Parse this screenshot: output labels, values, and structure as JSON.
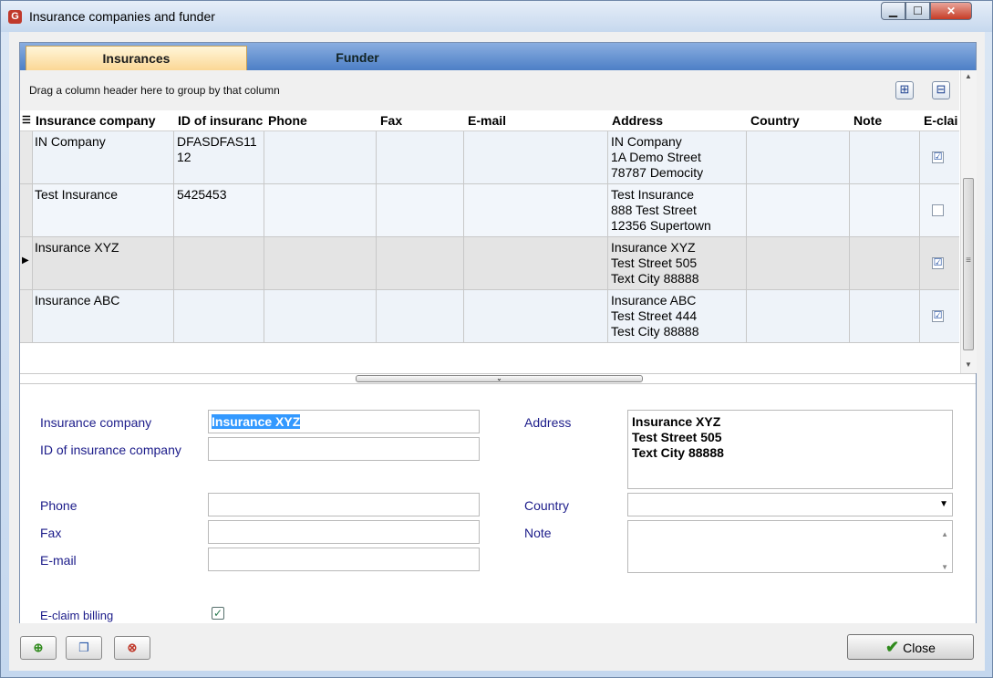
{
  "window": {
    "title": "Insurance companies and funder",
    "app_icon": "G"
  },
  "tabs": [
    {
      "label": "Insurances"
    },
    {
      "label": "Funder"
    }
  ],
  "grid": {
    "group_hint": "Drag a column header here to group by that column",
    "expand_icon": "⊞",
    "collapse_icon": "⊟",
    "headers": [
      "Insurance company",
      "ID of insurance",
      "Phone",
      "Fax",
      "E-mail",
      "Address",
      "Country",
      "Note",
      "E-clai"
    ],
    "rows": [
      {
        "company": "IN Company",
        "id_line1": "DFASDFAS11",
        "id_line2": "12",
        "addr1": "IN Company",
        "addr2": "1A Demo Street",
        "addr3": "78787 Democity",
        "eclaim": "☑"
      },
      {
        "company": "Test Insurance",
        "id_line1": "5425453",
        "id_line2": "",
        "addr1": "Test Insurance",
        "addr2": "888 Test Street",
        "addr3": "12356 Supertown",
        "eclaim": ""
      },
      {
        "company": "Insurance XYZ",
        "id_line1": "",
        "id_line2": "",
        "addr1": "Insurance XYZ",
        "addr2": "Test Street 505",
        "addr3": "Text City 88888",
        "eclaim": "☑"
      },
      {
        "company": "Insurance ABC",
        "id_line1": "",
        "id_line2": "",
        "addr1": "Insurance ABC",
        "addr2": "Test Street 444",
        "addr3": "Test City 88888",
        "eclaim": "☑"
      }
    ]
  },
  "form": {
    "company_label": "Insurance company",
    "company_value": "Insurance XYZ",
    "id_label": "ID of insurance company",
    "id_value": "",
    "phone_label": "Phone",
    "fax_label": "Fax",
    "email_label": "E-mail",
    "address_label": "Address",
    "address_value": "Insurance XYZ\nTest Street 505\nText City 88888",
    "country_label": "Country",
    "note_label": "Note",
    "eclaim_label": "E-claim billing",
    "eclaim_checked": "✓"
  },
  "buttons": {
    "close": "Close"
  },
  "colors": {
    "tab_active": "#fbd795",
    "tabbar": "#4d7fc6",
    "label": "#1c1c8a"
  }
}
